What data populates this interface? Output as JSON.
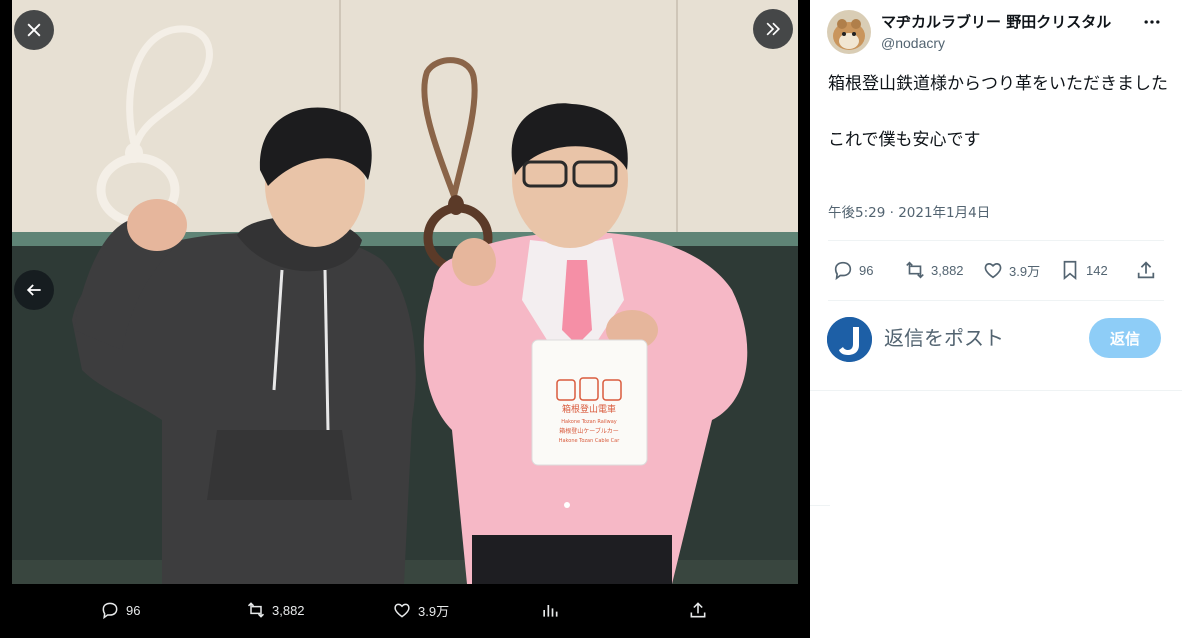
{
  "viewer": {
    "close_icon": "close-icon",
    "expand_icon": "chevron-double-right-icon",
    "prev_icon": "arrow-left-icon",
    "photo_bag_text": {
      "line1": "箱根登山電車",
      "line2": "Hakone Tozan Railway",
      "line3": "箱根登山ケーブルカー",
      "line4": "Hakone Tozan Cable Car"
    },
    "actions": {
      "replies": "96",
      "retweets": "3,882",
      "likes": "3.9万"
    }
  },
  "tweet": {
    "author_name": "マヂカルラブリー 野田クリスタル",
    "author_handle": "@nodacry",
    "text": "箱根登山鉄道様からつり革をいただきました\n\nこれで僕も安心です",
    "timestamp": "午後5:29 · 2021年1月4日",
    "stats": {
      "replies": "96",
      "retweets": "3,882",
      "likes": "3.9万",
      "bookmarks": "142"
    },
    "reply_placeholder": "返信をポスト",
    "reply_button": "返信"
  },
  "colors": {
    "accent": "#1d9bf0",
    "reply_button_disabled": "#8ecdf7",
    "secondary_text": "#536471"
  }
}
